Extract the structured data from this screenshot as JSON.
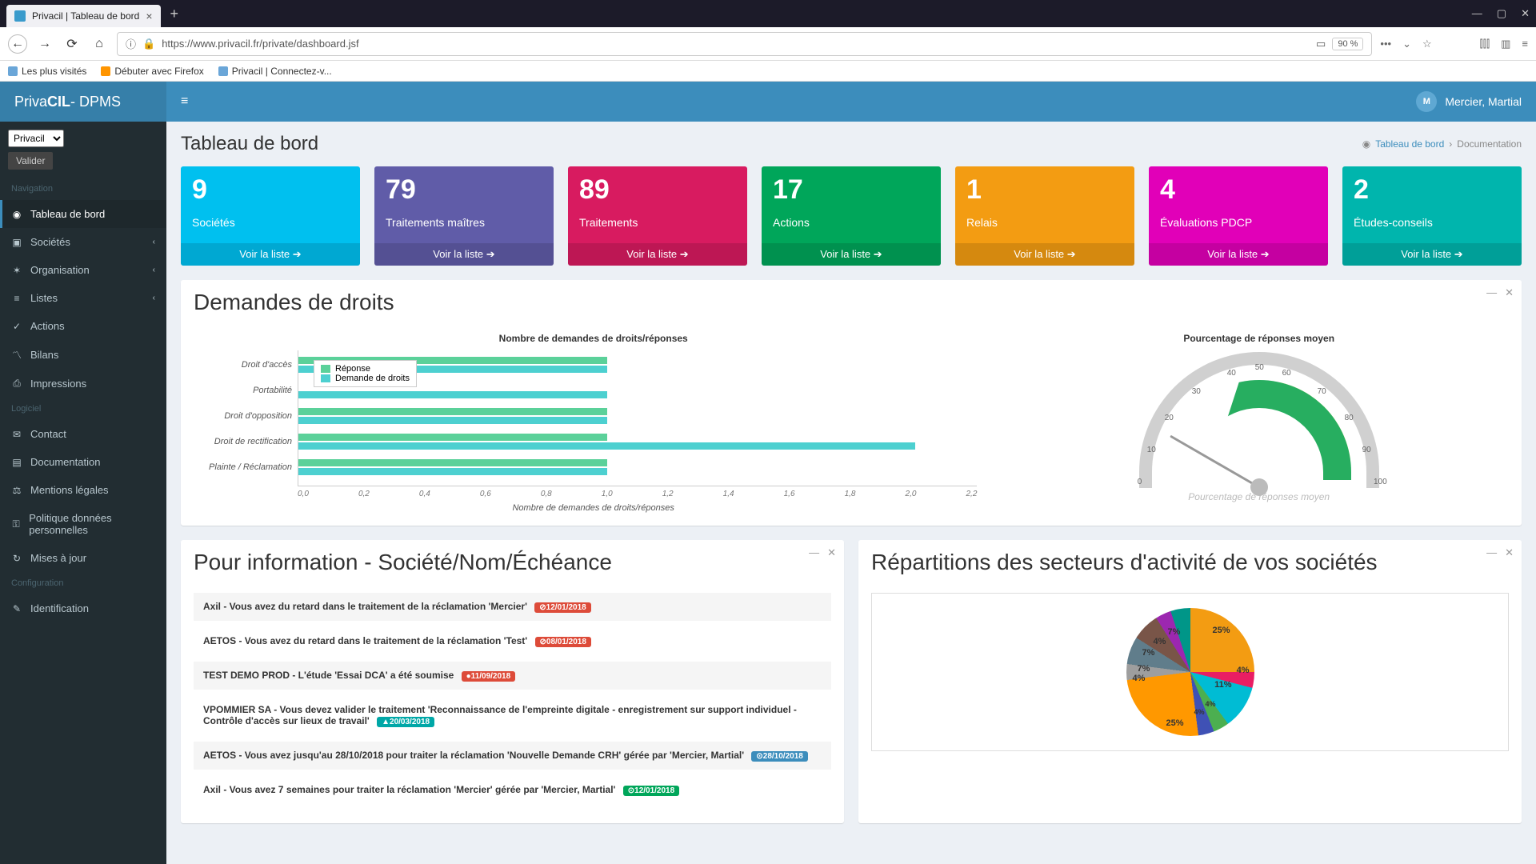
{
  "browser": {
    "tab_title": "Privacil | Tableau de bord",
    "url": "https://www.privacil.fr/private/dashboard.jsf",
    "zoom": "90 %",
    "bookmarks": [
      "Les plus visités",
      "Débuter avec Firefox",
      "Privacil | Connectez-v..."
    ]
  },
  "app": {
    "brand_prefix": "Priva",
    "brand_bold": "CIL",
    "brand_suffix": " - DPMS",
    "user_name": "Mercier, Martial"
  },
  "sidebar": {
    "select_value": "Privacil",
    "valider": "Valider",
    "headers": {
      "nav": "Navigation",
      "logiciel": "Logiciel",
      "config": "Configuration"
    },
    "items": [
      {
        "icon": "◉",
        "label": "Tableau de bord",
        "active": true
      },
      {
        "icon": "▣",
        "label": "Sociétés",
        "sub": true
      },
      {
        "icon": "✶",
        "label": "Organisation",
        "sub": true
      },
      {
        "icon": "≡",
        "label": "Listes",
        "sub": true
      },
      {
        "icon": "✓",
        "label": "Actions"
      },
      {
        "icon": "〽",
        "label": "Bilans"
      },
      {
        "icon": "⎙",
        "label": "Impressions"
      }
    ],
    "logiciel": [
      {
        "icon": "✉",
        "label": "Contact"
      },
      {
        "icon": "▤",
        "label": "Documentation"
      },
      {
        "icon": "⚖",
        "label": "Mentions légales"
      },
      {
        "icon": "⚿",
        "label": "Politique données personnelles"
      },
      {
        "icon": "↻",
        "label": "Mises à jour"
      }
    ],
    "config": [
      {
        "icon": "✎",
        "label": "Identification"
      }
    ]
  },
  "page": {
    "title": "Tableau de bord",
    "breadcrumb": {
      "home": "Tableau de bord",
      "current": "Documentation"
    }
  },
  "stats": [
    {
      "num": "9",
      "label": "Sociétés",
      "link": "Voir la liste",
      "color": "c-aqua"
    },
    {
      "num": "79",
      "label": "Traitements maîtres",
      "link": "Voir la liste",
      "color": "c-purple"
    },
    {
      "num": "89",
      "label": "Traitements",
      "link": "Voir la liste",
      "color": "c-maroon"
    },
    {
      "num": "17",
      "label": "Actions",
      "link": "Voir la liste",
      "color": "c-green"
    },
    {
      "num": "1",
      "label": "Relais",
      "link": "Voir la liste",
      "color": "c-orange"
    },
    {
      "num": "4",
      "label": "Évaluations PDCP",
      "link": "Voir la liste",
      "color": "c-pink"
    },
    {
      "num": "2",
      "label": "Études-conseils",
      "link": "Voir la liste",
      "color": "c-teal"
    }
  ],
  "panels": {
    "rights": {
      "title": "Demandes de droits",
      "bar_title": "Nombre de demandes de droits/réponses",
      "gauge_title": "Pourcentage de réponses moyen",
      "gauge_label": "Pourcentage de réponses moyen",
      "x_label": "Nombre de demandes de droits/réponses",
      "legend": {
        "reponse": "Réponse",
        "demande": "Demande de droits"
      }
    },
    "info": {
      "title": "Pour information - Société/Nom/Échéance"
    },
    "sectors": {
      "title": "Répartitions des secteurs d'activité de vos sociétés"
    }
  },
  "chart_data": {
    "bar": {
      "type": "bar",
      "orientation": "horizontal",
      "categories": [
        "Droit d'accès",
        "Portabilité",
        "Droit d'opposition",
        "Droit de rectification",
        "Plainte / Réclamation"
      ],
      "series": [
        {
          "name": "Réponse",
          "values": [
            1.0,
            0,
            1.0,
            1.0,
            1.0
          ],
          "color": "#5bd19a"
        },
        {
          "name": "Demande de droits",
          "values": [
            1.0,
            1.0,
            1.0,
            2.0,
            1.0
          ],
          "color": "#4dd0d0"
        }
      ],
      "xlim": [
        0,
        2.2
      ],
      "xticks": [
        "0,0",
        "0,2",
        "0,4",
        "0,6",
        "0,8",
        "1,0",
        "1,2",
        "1,4",
        "1,6",
        "1,8",
        "2,0",
        "2,2"
      ],
      "xlabel": "Nombre de demandes de droits/réponses"
    },
    "gauge": {
      "type": "gauge",
      "min": 0,
      "max": 100,
      "value": 18,
      "ticks": [
        0,
        10,
        20,
        30,
        40,
        50,
        60,
        70,
        80,
        90,
        100
      ],
      "zones": [
        {
          "color": "#e74c3c",
          "from": 0,
          "to": 20
        },
        {
          "color": "#f39c12",
          "from": 20,
          "to": 40
        },
        {
          "color": "#f1eb3b",
          "from": 40,
          "to": 60
        },
        {
          "color": "#27ae60",
          "from": 60,
          "to": 80
        }
      ]
    },
    "pie": {
      "type": "pie",
      "slices": [
        {
          "label": "25%",
          "value": 25,
          "color": "#f39c12"
        },
        {
          "label": "4%",
          "value": 4,
          "color": "#e91e63"
        },
        {
          "label": "11%",
          "value": 11,
          "color": "#00bcd4"
        },
        {
          "label": "4%",
          "value": 4,
          "color": "#4caf50"
        },
        {
          "label": "4%",
          "value": 4,
          "color": "#3f51b5"
        },
        {
          "label": "25%",
          "value": 25,
          "color": "#ff9800"
        },
        {
          "label": "4%",
          "value": 4,
          "color": "#9e9e9e"
        },
        {
          "label": "7%",
          "value": 7,
          "color": "#607d8b"
        },
        {
          "label": "7%",
          "value": 7,
          "color": "#795548"
        },
        {
          "label": "4%",
          "value": 4,
          "color": "#9c27b0"
        },
        {
          "label": "7%",
          "value": 7,
          "color": "#009688"
        }
      ]
    }
  },
  "info_items": [
    {
      "text": "Axil - Vous avez du retard dans le traitement de la réclamation 'Mercier'",
      "date": "12/01/2018",
      "cls": "db-red",
      "icon": "⊘"
    },
    {
      "text": "AETOS - Vous avez du retard dans le traitement de la réclamation 'Test'",
      "date": "08/01/2018",
      "cls": "db-red",
      "icon": "⊘"
    },
    {
      "text": "TEST DEMO PROD - L'étude 'Essai DCA' a été soumise",
      "date": "11/09/2018",
      "cls": "db-red",
      "icon": "●"
    },
    {
      "text": "VPOMMIER SA - Vous devez valider le traitement 'Reconnaissance de l'empreinte digitale - enregistrement sur support individuel - Contrôle d'accès sur lieux de travail'",
      "date": "20/03/2018",
      "cls": "db-teal",
      "icon": "▲"
    },
    {
      "text": "AETOS - Vous avez jusqu'au 28/10/2018 pour traiter la réclamation 'Nouvelle Demande CRH' gérée par 'Mercier, Martial'",
      "date": "28/10/2018",
      "cls": "db-blue",
      "icon": "⊙"
    },
    {
      "text": "Axil - Vous avez 7 semaines pour traiter la réclamation 'Mercier' gérée par 'Mercier, Martial'",
      "date": "12/01/2018",
      "cls": "db-green",
      "icon": "⊙"
    }
  ]
}
